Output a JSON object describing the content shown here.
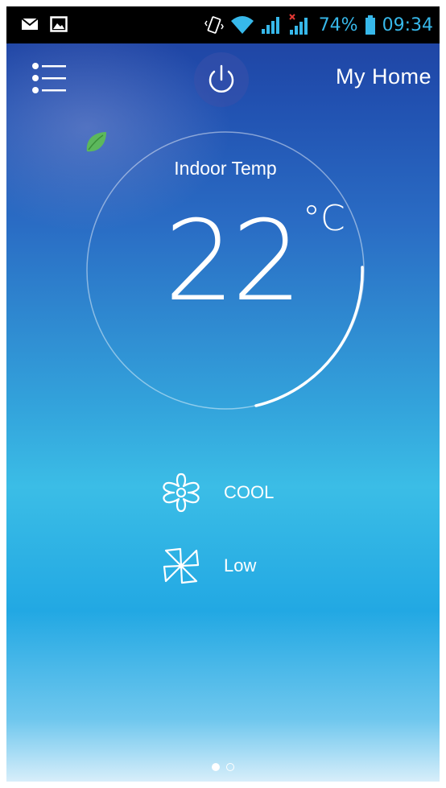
{
  "status_bar": {
    "battery_percent": "74%",
    "time": "09:34",
    "accent_color": "#37b8ea",
    "icons": [
      "mail-icon",
      "image-icon",
      "vibrate-icon",
      "wifi-icon",
      "signal-icon",
      "no-sim-signal-icon",
      "battery-icon"
    ]
  },
  "header": {
    "title": "My Home",
    "menu_icon": "list-menu-icon",
    "power_icon": "power-icon"
  },
  "dial": {
    "label": "Indoor Temp",
    "temperature": "22",
    "unit": "°C",
    "eco_icon": "leaf-icon",
    "leaf_color": "#5cb85c"
  },
  "modes": [
    {
      "icon": "snowflake-icon",
      "label": "COOL"
    },
    {
      "icon": "fan-icon",
      "label": "Low"
    }
  ],
  "pagination": {
    "total": 2,
    "active": 1
  }
}
